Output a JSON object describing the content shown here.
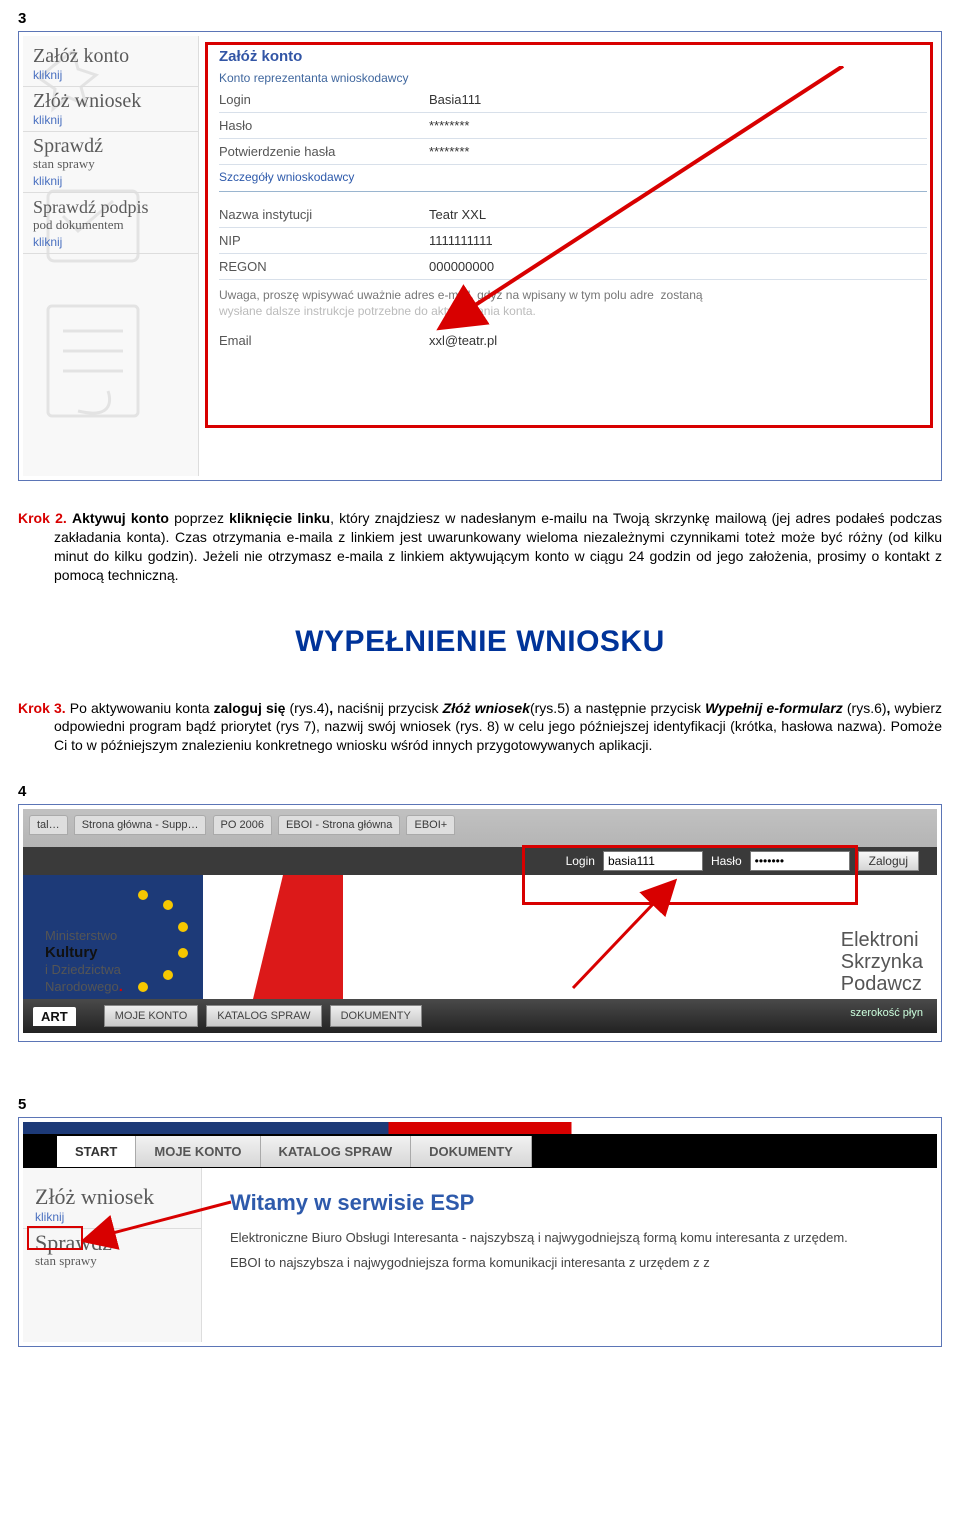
{
  "fig3": {
    "label": "3",
    "sidebar": [
      {
        "title": "Załóż konto",
        "sub": "",
        "link": "kliknij"
      },
      {
        "title": "Złóż wniosek",
        "sub": "",
        "link": "kliknij"
      },
      {
        "title": "Sprawdź",
        "sub": "stan sprawy",
        "link": "kliknij"
      },
      {
        "title": "Sprawdź podpis",
        "sub": "pod dokumentem",
        "link": "kliknij"
      }
    ],
    "form": {
      "heading": "Załóż konto",
      "sub1": "Konto reprezentanta wnioskodawcy",
      "login_l": "Login",
      "login_v": "Basia111",
      "haslo_l": "Hasło",
      "haslo_v": "********",
      "potw_l": "Potwierdzenie hasła",
      "potw_v": "********",
      "sub2": "Szczegóły wnioskodawcy",
      "inst_l": "Nazwa instytucji",
      "inst_v": "Teatr XXL",
      "nip_l": "NIP",
      "nip_v": "1111111111",
      "regon_l": "REGON",
      "regon_v": "000000000",
      "warn1": "Uwaga, proszę wpisywać uważnie adres e-mail, gdyż na wpisany w tym polu adre",
      "warn1b": "zostaną",
      "warn2": "wysłane dalsze instrukcje potrzebne do aktywowania konta.",
      "email_l": "Email",
      "email_v": "xxl@teatr.pl"
    }
  },
  "krok2": {
    "label": "Krok 2.",
    "text": "Aktywuj konto poprzez kliknięcie linku, który znajdziesz w nadesłanym e-mailu na Twoją skrzynkę mailową (jej adres podałeś podczas zakładania konta). Czas otrzymania e-maila z linkiem jest uwarunkowany wieloma niezależnymi czynnikami toteż może być różny (od kilku minut do kilku godzin). Jeżeli nie otrzymasz e-maila z linkiem aktywującym konto w ciągu 24 godzin od jego założenia, prosimy o kontakt z pomocą techniczną.",
    "b1": "Aktywuj konto",
    "b2": "kliknięcie linku"
  },
  "big_title": "WYPEŁNIENIE WNIOSKU",
  "krok3": {
    "label": "Krok 3.",
    "pre": "Po aktywowaniu konta ",
    "b1": "zaloguj się",
    "mid1": " (rys.4)",
    "b2": ", ",
    "mid2": "naciśnij przycisk ",
    "bi1": "Złóż wniosek",
    "mid3": "(rys.5) a następnie przycisk ",
    "bi2": "Wypełnij e-formularz",
    "mid4": " (rys.6)",
    "b3": ", ",
    "mid5": "wybierz odpowiedni program bądź priorytet (rys 7), nazwij swój wniosek (rys. 8) w celu jego późniejszej identyfikacji (krótka, hasłowa nazwa). Pomoże Ci to w późniejszym znalezieniu konkretnego wniosku wśród innych przygotowywanych aplikacji."
  },
  "fig4": {
    "label": "4",
    "tabs": [
      "tal…",
      "Strona główna - Supp…",
      "PO 2006",
      "EBOI - Strona główna",
      "EBOI+"
    ],
    "login_l": "Login",
    "login_v": "basia111",
    "haslo_l": "Hasło",
    "haslo_v": "•••••••",
    "login_btn": "Zaloguj",
    "ministry_l1": "Ministerstwo",
    "ministry_l2": "Kultury",
    "ministry_l3a": "i Dziedzictwa",
    "ministry_l3b": "Narodowego",
    "ministry_dot": ".",
    "right_l1": "Elektroni",
    "right_l2": "Skrzynka",
    "right_l3": "Podawcz",
    "art": "ART",
    "menu": [
      "MOJE KONTO",
      "KATALOG SPRAW",
      "DOKUMENTY"
    ],
    "szero": "szerokość płyn"
  },
  "fig5": {
    "label": "5",
    "tabs": [
      "START",
      "MOJE KONTO",
      "KATALOG SPRAW",
      "DOKUMENTY"
    ],
    "side1_title": "Złóż wniosek",
    "side1_link": "kliknij",
    "side2_title": "Sprawdź",
    "side2_sub": "stan sprawy",
    "heading": "Witamy w serwisie ESP",
    "p1": "Elektroniczne Biuro Obsługi Interesanta - najszybszą i najwygodniejszą formą komu interesanta z urzędem.",
    "p2": "EBOI to najszybsza i najwygodniejsza forma komunikacji interesanta z urzędem z z"
  }
}
